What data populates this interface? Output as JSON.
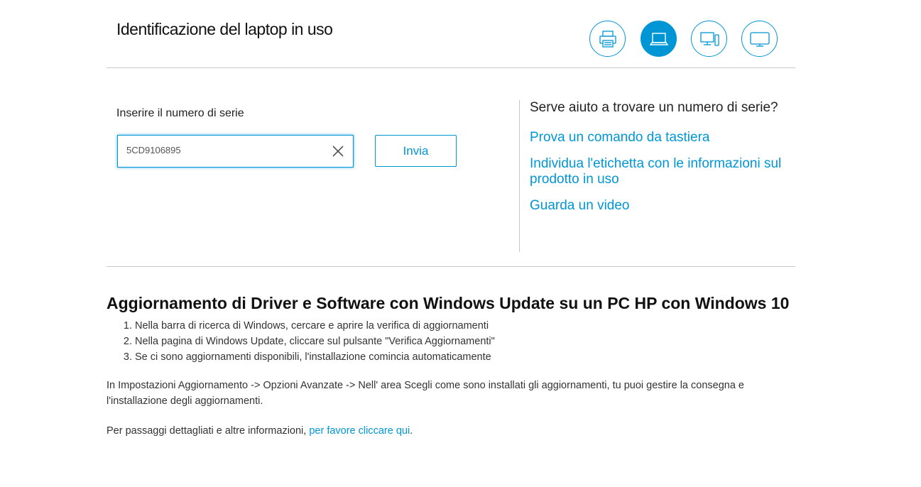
{
  "header": {
    "title": "Identificazione del laptop in uso",
    "device_icons": [
      {
        "name": "printer-icon",
        "active": false
      },
      {
        "name": "laptop-icon",
        "active": true
      },
      {
        "name": "desktop-icon",
        "active": false
      },
      {
        "name": "monitor-icon",
        "active": false
      }
    ]
  },
  "serial_form": {
    "label": "Inserire il numero di serie",
    "value": "5CD9106895",
    "submit_label": "Invia"
  },
  "help": {
    "title": "Serve aiuto a trovare un numero di serie?",
    "links": [
      "Prova un comando da tastiera",
      "Individua l'etichetta con le informazioni sul prodotto in uso",
      "Guarda un video"
    ]
  },
  "article": {
    "title": "Aggiornamento di Driver e Software con Windows Update su un PC HP con Windows 10",
    "steps": [
      "Nella barra di ricerca di Windows, cercare e aprire la verifica di aggiornamenti",
      "Nella pagina di Windows Update, cliccare sul pulsante \"Verifica Aggiornamenti\"",
      "Se ci sono aggiornamenti disponibili, l'installazione comincia automaticamente"
    ],
    "paragraph": "In Impostazioni Aggiornamento -> Opzioni Avanzate -> Nell' area Scegli come sono installati gli aggiornamenti, tu puoi gestire la consegna e l'installazione degli aggiornamenti.",
    "more_prefix": "Per passaggi dettagliati e altre informazioni, ",
    "more_link": "per favore cliccare qui",
    "more_suffix": "."
  },
  "colors": {
    "accent": "#0096d6",
    "rule": "#c8c8c8"
  }
}
